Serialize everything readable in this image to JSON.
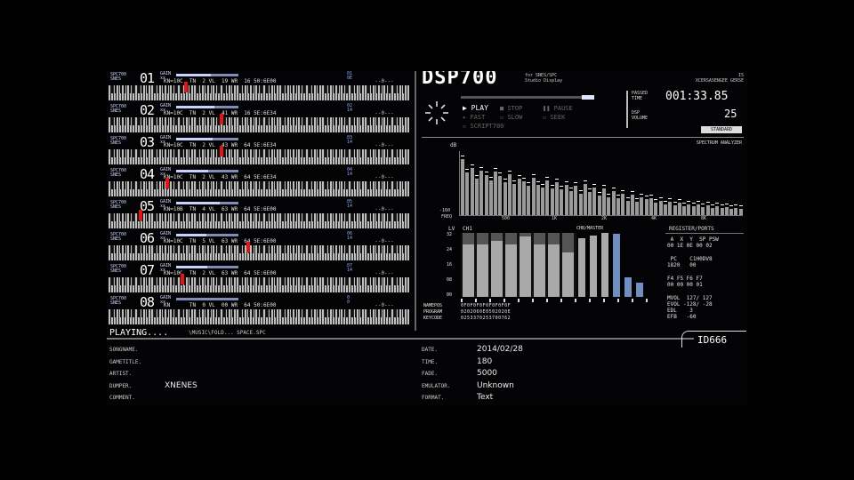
{
  "app": {
    "logo": "DSP700",
    "subtitle_line1": "for SNES/SPC",
    "subtitle_line2": "Studio Display",
    "corner_code": "IS",
    "corner_sub": "XCERSASENGEE GERSE"
  },
  "channels": [
    {
      "tag": "SPC700\nSNES",
      "num": "01",
      "src": "GAIN\nxx",
      "info": "KN=10C  TN  2 VL  19 WR  16 50:6E00",
      "env": "01\n0E",
      "line": "  --0---",
      "bar_pct": 0.55,
      "hit": 0.25,
      "blk": [
        0.06,
        0.14,
        0.27,
        0.35,
        0.48,
        0.56,
        0.69,
        0.77,
        0.9
      ]
    },
    {
      "tag": "SPC700\nSNES",
      "num": "02",
      "src": "GAIN\nxx",
      "info": "KN=10C  TN  2 VL  41 WR  16 5E:6E34",
      "env": "02\n14",
      "line": "  --0---",
      "bar_pct": 0.62,
      "hit": 0.37,
      "blk": [
        0.06,
        0.14,
        0.27,
        0.35,
        0.48,
        0.56,
        0.69,
        0.77,
        0.9
      ]
    },
    {
      "tag": "SPC700\nSNES",
      "num": "03",
      "src": "GAIN\nxx",
      "info": "KN=10C  TN  2 VL  43 WR  64 5E:6E34",
      "env": "03\n14",
      "line": "  --0---",
      "bar_pct": 0.58,
      "hit": 0.37,
      "blk": [
        0.06,
        0.14,
        0.27,
        0.35,
        0.48,
        0.56,
        0.69,
        0.77,
        0.9
      ]
    },
    {
      "tag": "SPC700\nSNES",
      "num": "04",
      "src": "GAIN\nxx",
      "info": "KN=10C  TN  2 VL  43 WR  64 5E:6E34",
      "env": "04\n14",
      "line": "  --0---",
      "bar_pct": 0.52,
      "hit": 0.19,
      "blk": [
        0.06,
        0.14,
        0.27,
        0.35,
        0.48,
        0.56,
        0.69,
        0.77,
        0.9
      ]
    },
    {
      "tag": "SPC700\nSNES",
      "num": "05",
      "src": "GAIN\nxx",
      "info": "KN=10B  TN  4 VL  63 WR  64 5E:6E00",
      "env": "05\n14",
      "line": "  --0---",
      "bar_pct": 0.7,
      "hit": 0.1,
      "blk": [
        0.06,
        0.14,
        0.27,
        0.35,
        0.48,
        0.56,
        0.69,
        0.77,
        0.9
      ]
    },
    {
      "tag": "SPC700\nSNES",
      "num": "06",
      "src": "GAIN\nxx",
      "info": "KN=10C  TN  5 VL  63 WR  64 5E:6E00",
      "env": "06\n14",
      "line": "  --0---",
      "bar_pct": 0.48,
      "hit": 0.46,
      "blk": [
        0.06,
        0.14,
        0.27,
        0.35,
        0.48,
        0.56,
        0.69,
        0.77,
        0.9
      ]
    },
    {
      "tag": "SPC700\nSNES",
      "num": "07",
      "src": "GAIN\nxx",
      "info": "KN=10C  TN  2 VL  63 WR  64 5E:6E00",
      "env": "07\n14",
      "line": "  --0---",
      "bar_pct": 0.5,
      "hit": 0.24,
      "blk": [
        0.06,
        0.14,
        0.27,
        0.35,
        0.48,
        0.56,
        0.69,
        0.77,
        0.9
      ]
    },
    {
      "tag": "SPC700\nSNES",
      "num": "08",
      "src": "GAIN\nxx",
      "info": "KN      TN  0 VL  00 WR  64 50:6E00",
      "env": "0\n0",
      "line": "  --0---",
      "bar_pct": 0,
      "hit": -1,
      "blk": [
        0.06,
        0.14,
        0.27,
        0.35,
        0.48,
        0.56,
        0.69,
        0.77,
        0.9
      ]
    }
  ],
  "transport": {
    "play": "PLAY",
    "stop": "STOP",
    "pause": "PAUSE",
    "fast": "FAST",
    "slow": "SLOW",
    "seek": "SEEK",
    "script": "SCRIPT700",
    "passed_label": "PASSED\nTIME",
    "passed_time": "001:33.85",
    "dsp_label": "DSP\nVOLUME",
    "dsp_volume": "25",
    "mode_btn": "STANDARD"
  },
  "spectrum": {
    "title": "SPECTRUM ANALYZER",
    "db_top": "dB",
    "db_bottom": "-160",
    "freq_label": "FREQ",
    "freq_ticks": [
      "500",
      "1K",
      "2K",
      "4K",
      "8K"
    ],
    "levels": [
      0.92,
      0.7,
      0.78,
      0.6,
      0.74,
      0.66,
      0.58,
      0.72,
      0.64,
      0.55,
      0.68,
      0.52,
      0.6,
      0.56,
      0.48,
      0.62,
      0.5,
      0.46,
      0.58,
      0.44,
      0.54,
      0.42,
      0.5,
      0.4,
      0.48,
      0.36,
      0.52,
      0.38,
      0.46,
      0.33,
      0.44,
      0.3,
      0.4,
      0.28,
      0.36,
      0.24,
      0.34,
      0.22,
      0.3,
      0.26,
      0.28,
      0.2,
      0.24,
      0.18,
      0.22,
      0.16,
      0.2,
      0.15,
      0.18,
      0.14,
      0.17,
      0.13,
      0.16,
      0.12,
      0.14,
      0.12,
      0.13,
      0.11,
      0.12,
      0.1
    ]
  },
  "channel_meters": {
    "lv_label": "LV",
    "ch_label": "CH1",
    "cv_label": "CH8/MASTER",
    "ticks": [
      "32",
      "24",
      "16",
      "08",
      "00"
    ],
    "levels": [
      0.82,
      0.82,
      0.88,
      0.82,
      0.95,
      0.82,
      0.82,
      0.7
    ],
    "master": [
      0.92,
      0.96,
      1.0,
      0.98,
      0.3,
      0.22
    ]
  },
  "registers": {
    "title": "REGISTER/PORTS",
    "row1": " A  X  Y  SP PSW",
    "row2": "00 1E 0E 00 02",
    "row3": " PC    C1H0DV8",
    "row4": "1820   00",
    "row5": "F4 F5 F6 F7",
    "row6": "00 00 00 01",
    "row7": "MVOL  127/ 127",
    "row8": "EVOL -128/ -28",
    "row9": "EDL    3",
    "row10": "EFB   -60"
  },
  "namerows": {
    "names_label": "NAMEPOS\nPROGRAM\nKEYCODE",
    "names_values": "0F0F0F0F0F0F0F0F\n0202060E0502020E\n0253370253700762"
  },
  "status": {
    "playing": "PLAYING....",
    "path": "\\MUSIC\\FOLD... SPACE.SPC",
    "id": "ID666"
  },
  "tags_left": [
    {
      "label": "SONGNAME.",
      "value": ""
    },
    {
      "label": "GAMETITLE.",
      "value": ""
    },
    {
      "label": "ARTIST.",
      "value": ""
    },
    {
      "label": "DUMPER.",
      "value": "XNENES"
    },
    {
      "label": "COMMENT.",
      "value": ""
    }
  ],
  "tags_right": [
    {
      "label": "DATE.",
      "value": "2014/02/28"
    },
    {
      "label": "TIME.",
      "value": "180"
    },
    {
      "label": "FADE.",
      "value": "5000"
    },
    {
      "label": "EMULATOR.",
      "value": "Unknown"
    },
    {
      "label": "FORMAT.",
      "value": "Text"
    }
  ],
  "colors": {
    "accent": "#8fa9ff",
    "hit": "#e01515",
    "meter": "#a9a9a9",
    "master_blue": "#6e8fbf"
  }
}
